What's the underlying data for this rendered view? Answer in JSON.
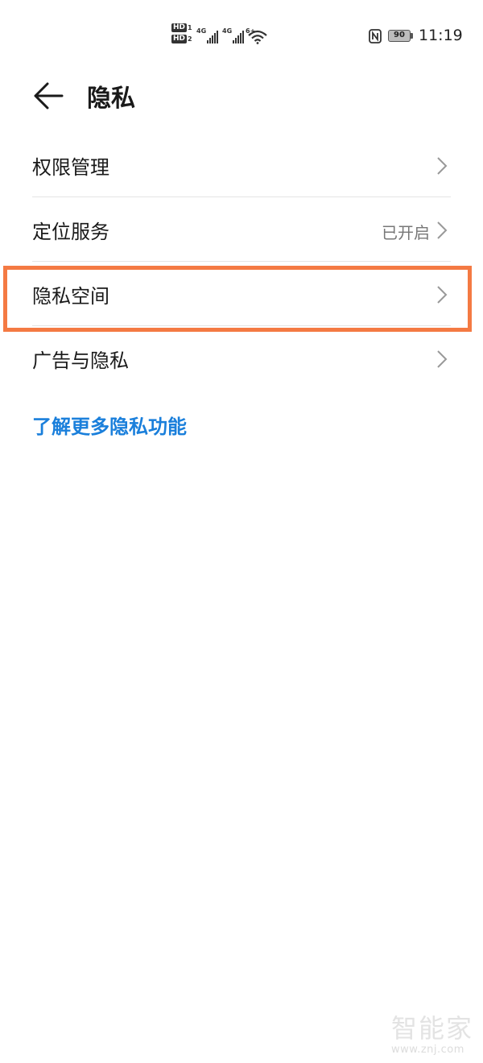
{
  "status_bar": {
    "hd1": "HD",
    "hd1_num": "1",
    "hd2": "HD",
    "hd2_num": "2",
    "signal1_label": "4G",
    "signal2_label": "4G",
    "wifi_label": "6+",
    "battery": "90",
    "time": "11:19"
  },
  "header": {
    "title": "隐私"
  },
  "menu": {
    "items": [
      {
        "label": "权限管理",
        "value": ""
      },
      {
        "label": "定位服务",
        "value": "已开启"
      },
      {
        "label": "隐私空间",
        "value": ""
      },
      {
        "label": "广告与隐私",
        "value": ""
      }
    ]
  },
  "link": {
    "learn_more": "了解更多隐私功能"
  },
  "watermark": {
    "logo": "智能家",
    "url": "www.znj.com"
  },
  "colors": {
    "highlight": "#f47a43",
    "link": "#1a7fdb"
  },
  "icons": [
    "back-arrow-icon",
    "chevron-right-icon",
    "nfc-icon",
    "battery-icon",
    "wifi-icon",
    "signal-icon"
  ]
}
